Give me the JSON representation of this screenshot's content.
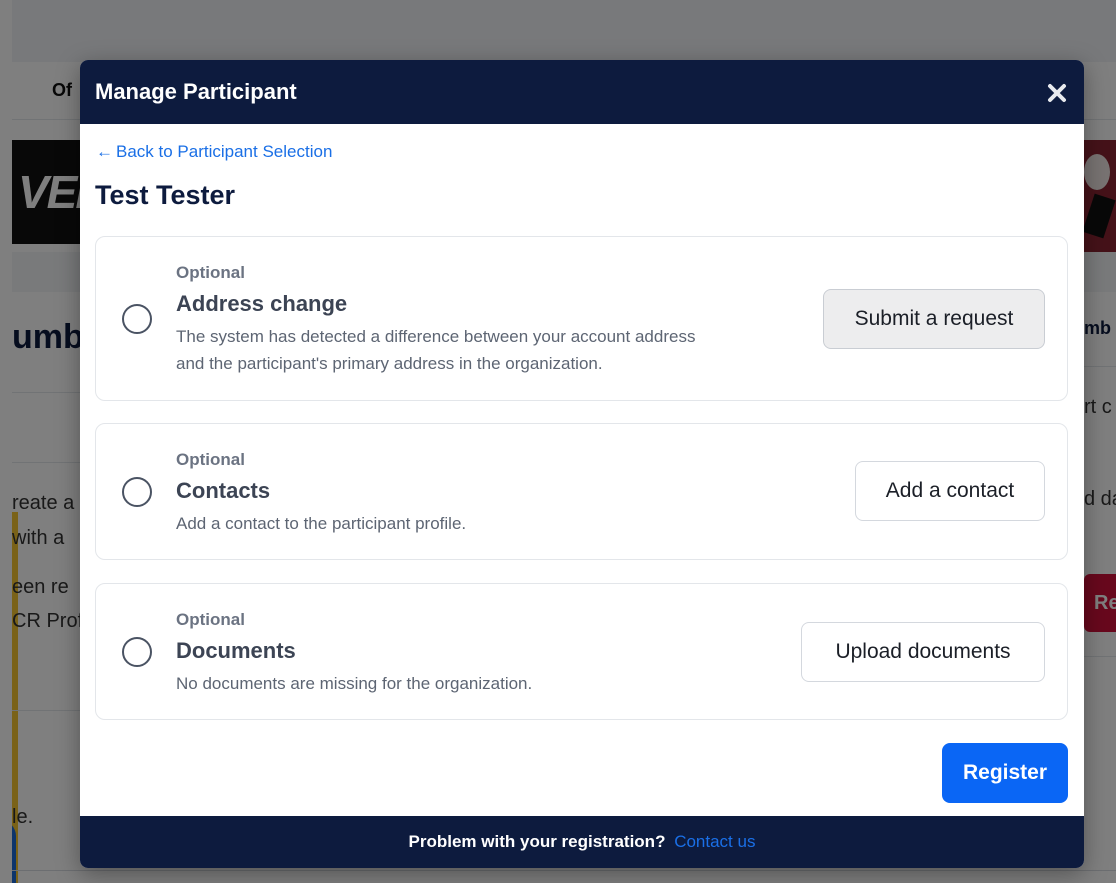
{
  "modal": {
    "title": "Manage Participant",
    "back_label": "Back to Participant Selection",
    "participant_name": "Test Tester",
    "cards": [
      {
        "optional_label": "Optional",
        "title": "Address change",
        "desc_line1": "The system has detected a difference between your account address",
        "desc_line2": "and the participant's primary address in the organization.",
        "button_label": "Submit a request"
      },
      {
        "optional_label": "Optional",
        "title": "Contacts",
        "desc_line1": "Add a contact to the participant profile.",
        "button_label": "Add a contact"
      },
      {
        "optional_label": "Optional",
        "title": "Documents",
        "desc_line1": "No documents are missing for the organization.",
        "button_label": "Upload documents"
      }
    ],
    "register_label": "Register",
    "footer_text": "Problem with your registration?",
    "footer_link": "Contact us"
  },
  "background": {
    "nav_text": "Of",
    "banner_text": "VER",
    "heading_left": "umb",
    "heading_right": "mb",
    "text_right_1": "rt c",
    "text_right_2": "d da",
    "red_button": "Re",
    "text_left_1": "reate a",
    "text_left_2": "with a",
    "text_left_3": "een re",
    "text_left_4": "CR Prof",
    "text_left_5": "le."
  },
  "colors": {
    "navy": "#0d1b3e",
    "link_blue": "#1a6fe6",
    "primary_blue": "#0a66f5"
  },
  "icons": {
    "close": "close-icon",
    "back": "arrow-left-icon"
  }
}
